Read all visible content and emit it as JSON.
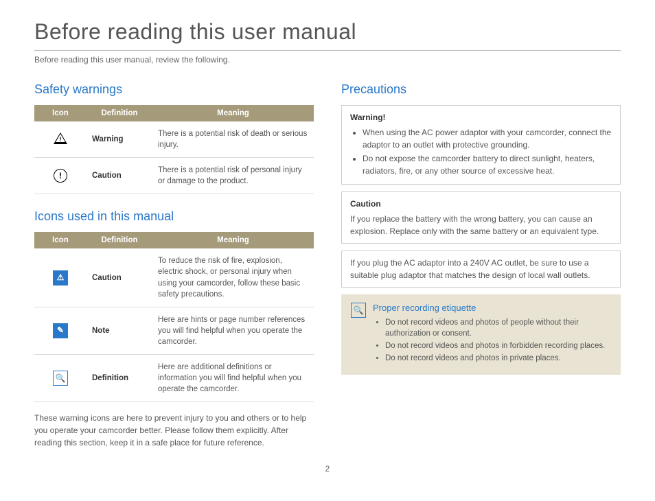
{
  "page": {
    "title": "Before reading this user manual",
    "intro": "Before reading this user manual, review the following.",
    "number": "2"
  },
  "safety": {
    "heading": "Safety warnings",
    "headers": {
      "icon": "Icon",
      "definition": "Definition",
      "meaning": "Meaning"
    },
    "rows": [
      {
        "definition": "Warning",
        "meaning": "There is a potential risk of death or serious injury."
      },
      {
        "definition": "Caution",
        "meaning": "There is a potential risk of personal injury or damage to the product."
      }
    ]
  },
  "icons": {
    "heading": "Icons used in this manual",
    "headers": {
      "icon": "Icon",
      "definition": "Definition",
      "meaning": "Meaning"
    },
    "rows": [
      {
        "definition": "Caution",
        "meaning": "To reduce the risk of fire, explosion, electric shock, or personal injury when using your camcorder, follow these basic safety precautions."
      },
      {
        "definition": "Note",
        "meaning": "Here are hints or page number references you will find helpful when you operate the camcorder."
      },
      {
        "definition": "Definition",
        "meaning": "Here are additional definitions or information you will find helpful when you operate the camcorder."
      }
    ],
    "footer": "These warning icons are here to prevent injury to you and others or to help you operate your camcorder better. Please follow them explicitly. After reading this section, keep it in a safe place for future reference."
  },
  "precautions": {
    "heading": "Precautions",
    "warning": {
      "title": "Warning!",
      "items": [
        "When using the AC power adaptor with your camcorder, connect the adaptor to an outlet with protective grounding.",
        "Do not expose the camcorder battery to direct sunlight, heaters, radiators, fire, or any other source of excessive heat."
      ]
    },
    "caution": {
      "title": "Caution",
      "text": "If you replace the battery with the wrong battery, you can cause an explosion. Replace only with the same battery or an equivalent type."
    },
    "note": {
      "text": "If you plug the AC adaptor into a 240V AC outlet, be sure to use a suitable plug adaptor that matches the design of local wall outlets."
    },
    "etiquette": {
      "title": "Proper recording etiquette",
      "items": [
        "Do not record videos and photos of people without their authorization or consent.",
        "Do not record videos and photos in forbidden recording places.",
        "Do not record videos and photos in private places."
      ]
    }
  }
}
